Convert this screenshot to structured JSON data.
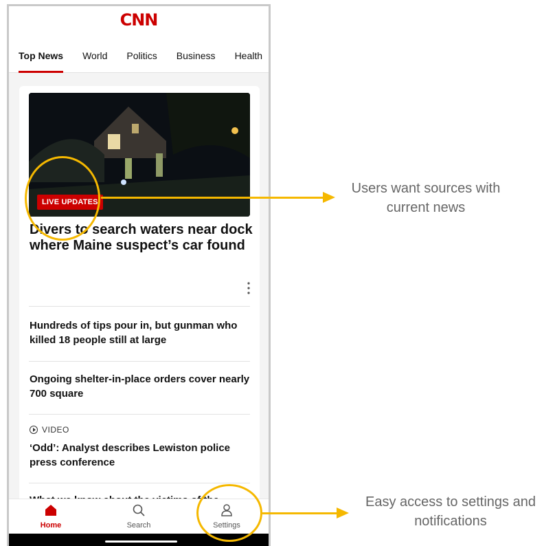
{
  "app": {
    "logo": "CNN"
  },
  "tabs": [
    {
      "label": "Top News",
      "active": true
    },
    {
      "label": "World"
    },
    {
      "label": "Politics"
    },
    {
      "label": "Business"
    },
    {
      "label": "Health"
    }
  ],
  "lead": {
    "badge": "LIVE UPDATES",
    "headline": "Divers to search waters near dock where Maine suspect’s car found",
    "more_icon": "more-vertical-icon"
  },
  "stories": [
    {
      "title": "Hundreds of tips pour in, but gunman who killed 18 people still at large"
    },
    {
      "title": "Ongoing shelter-in-place orders cover nearly 700 square"
    },
    {
      "kind": "VIDEO",
      "title": "‘Odd’: Analyst describes Lewiston police press conference"
    },
    {
      "title": "What we know about the victims of the"
    }
  ],
  "bottom_nav": [
    {
      "label": "Home",
      "icon": "home-icon",
      "active": true
    },
    {
      "label": "Search",
      "icon": "search-icon"
    },
    {
      "label": "Settings",
      "icon": "person-icon"
    }
  ],
  "annotations": [
    {
      "text": "Users want sources with current news"
    },
    {
      "text": "Easy access to settings and notifications"
    }
  ],
  "colors": {
    "brand": "#cc0000",
    "highlight": "#f5b800"
  }
}
